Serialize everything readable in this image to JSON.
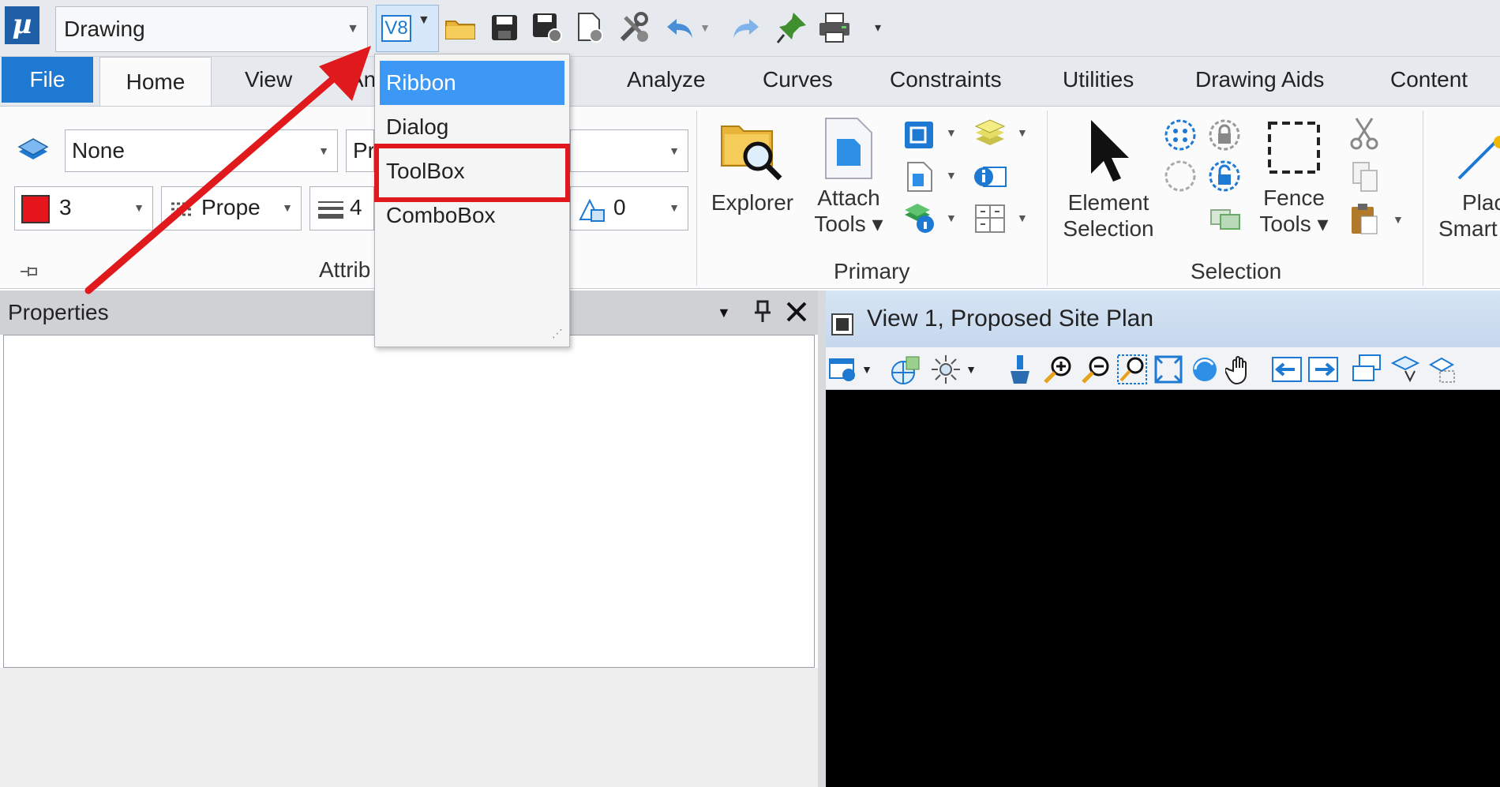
{
  "quick_access": {
    "workflow_value": "Drawing",
    "v8_label": "V8",
    "icons": [
      "open-folder-icon",
      "save-icon",
      "save-settings-icon",
      "file-settings-icon",
      "tools-settings-icon",
      "undo-icon",
      "undo-dropdown-icon",
      "redo-icon",
      "pin-icon",
      "print-icon",
      "customize-qat-icon"
    ]
  },
  "tabs": {
    "file": "File",
    "home": "Home",
    "view": "View",
    "partial": "An",
    "analyze": "Analyze",
    "curves": "Curves",
    "constraints": "Constraints",
    "utilities": "Utilities",
    "drawing_aids": "Drawing Aids",
    "content": "Content"
  },
  "ribbon": {
    "attributes": {
      "level_value": "None",
      "second_value": "Pr",
      "color_value": "3",
      "style_value": "Prope",
      "weight_value": "4",
      "transparency_value": "0",
      "label": "Attrib"
    },
    "primary": {
      "explorer_label": "Explorer",
      "attach_line1": "Attach",
      "attach_line2": "Tools ▾",
      "label": "Primary"
    },
    "selection": {
      "element_line1": "Element",
      "element_line2": "Selection",
      "fence_line1": "Fence",
      "fence_line2": "Tools ▾",
      "label": "Selection"
    },
    "place": {
      "line1": "Plac",
      "line2": "Smart"
    }
  },
  "properties": {
    "title": "Properties"
  },
  "view": {
    "title": "View 1, Proposed Site Plan"
  },
  "menu": {
    "items": [
      "Ribbon",
      "Dialog",
      "ToolBox",
      "ComboBox"
    ],
    "selected": "Ribbon",
    "highlighted": "ToolBox"
  },
  "colors": {
    "accent_blue": "#1d79d2",
    "menu_selected": "#3d97f5",
    "annotation_red": "#e0191d",
    "view_canvas": "#000000"
  }
}
